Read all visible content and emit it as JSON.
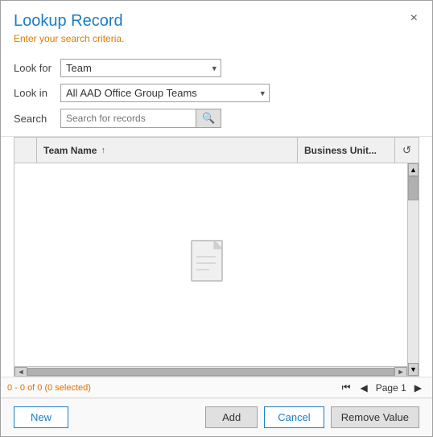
{
  "dialog": {
    "title": "Lookup Record",
    "subtitle": "Enter your search criteria.",
    "close_label": "×"
  },
  "form": {
    "look_for_label": "Look for",
    "look_in_label": "Look in",
    "search_label": "Search",
    "look_for_value": "Team",
    "look_in_value": "All AAD Office Group Teams",
    "search_placeholder": "Search for records",
    "look_for_options": [
      "Team"
    ],
    "look_in_options": [
      "All AAD Office Group Teams"
    ]
  },
  "table": {
    "col_team_name": "Team Name",
    "col_business_unit": "Business Unit...",
    "sort_arrow": "↑"
  },
  "status": {
    "record_count": "0 - 0 of 0 (0 selected)",
    "page_label": "Page 1"
  },
  "footer": {
    "new_label": "New",
    "add_label": "Add",
    "cancel_label": "Cancel",
    "remove_label": "Remove Value"
  },
  "icons": {
    "search": "🔍",
    "refresh": "↺",
    "first_page": "⏮",
    "prev_page": "◀",
    "next_page": "▶",
    "scroll_up": "▲",
    "scroll_down": "▼",
    "scroll_left": "◄",
    "scroll_right": "►"
  }
}
